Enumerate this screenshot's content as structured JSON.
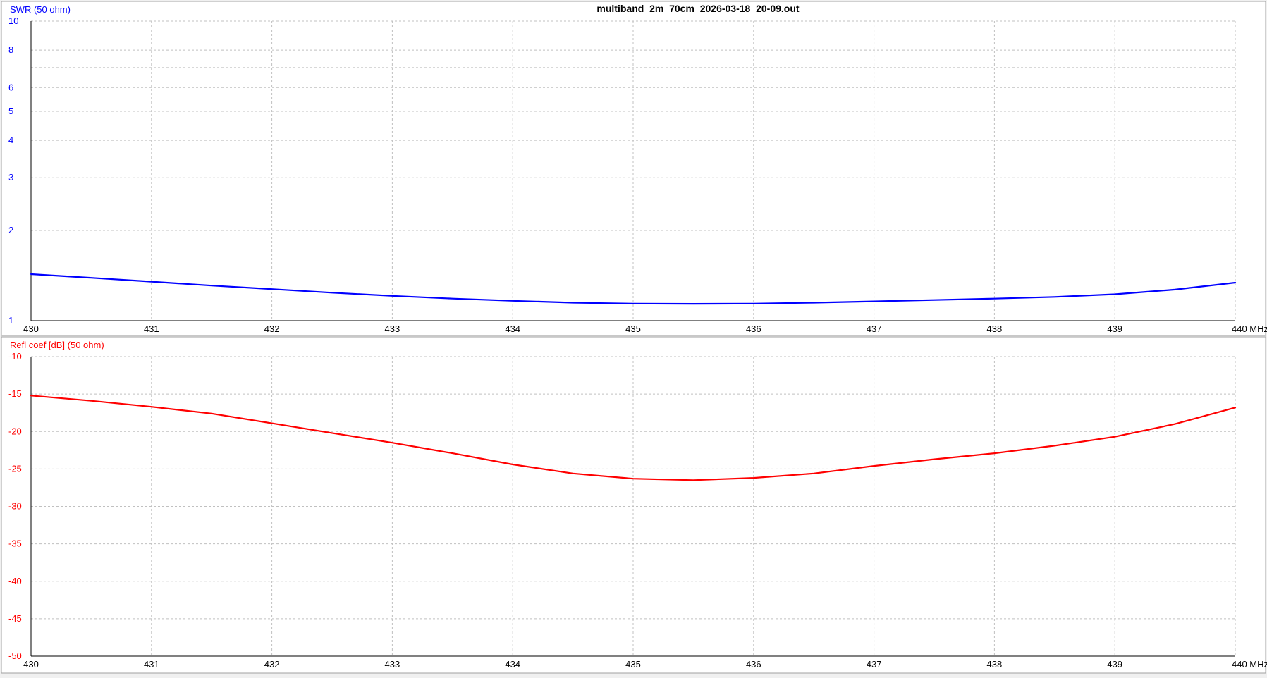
{
  "window": {
    "title": "multiband_2m_70cm_2026-03-18_20-09.out"
  },
  "colors": {
    "background": "#ffffff",
    "grid": "#c0c0c0",
    "axis": "#000000",
    "swr": "#0000ff",
    "refl": "#ff0000"
  },
  "chart_data": [
    {
      "type": "line",
      "ylabel": "SWR (50 ohm)",
      "xunit": "MHz",
      "xlim": [
        430,
        440
      ],
      "ylim": [
        1,
        10
      ],
      "yscale": "log",
      "grid": true,
      "x_ticks": [
        430,
        431,
        432,
        433,
        434,
        435,
        436,
        437,
        438,
        439,
        440
      ],
      "x_tick_labels": [
        "430",
        "431",
        "432",
        "433",
        "434",
        "435",
        "436",
        "437",
        "438",
        "439",
        "440 MHz"
      ],
      "y_ticks": [
        1,
        2,
        3,
        4,
        5,
        6,
        8,
        10
      ],
      "y_tick_labels": [
        "1",
        "2",
        "3",
        "4",
        "5",
        "6",
        "8",
        "10"
      ],
      "y_gridlines": [
        1,
        2,
        3,
        4,
        5,
        6,
        7,
        8,
        9,
        10
      ],
      "series": [
        {
          "x": [
            430,
            430.5,
            431,
            431.5,
            432,
            432.5,
            433,
            433.5,
            434,
            434.5,
            435,
            435.5,
            436,
            436.5,
            437,
            437.5,
            438,
            438.5,
            439,
            439.5,
            440
          ],
          "y": [
            1.43,
            1.39,
            1.35,
            1.31,
            1.275,
            1.24,
            1.21,
            1.185,
            1.165,
            1.148,
            1.14,
            1.138,
            1.14,
            1.148,
            1.16,
            1.172,
            1.185,
            1.2,
            1.225,
            1.27,
            1.34
          ]
        }
      ]
    },
    {
      "type": "line",
      "ylabel": "Refl coef [dB] (50 ohm)",
      "xunit": "MHz",
      "xlim": [
        430,
        440
      ],
      "ylim": [
        -50,
        -10
      ],
      "grid": true,
      "x_ticks": [
        430,
        431,
        432,
        433,
        434,
        435,
        436,
        437,
        438,
        439,
        440
      ],
      "x_tick_labels": [
        "430",
        "431",
        "432",
        "433",
        "434",
        "435",
        "436",
        "437",
        "438",
        "439",
        "440 MHz"
      ],
      "y_ticks": [
        -10,
        -15,
        -20,
        -25,
        -30,
        -35,
        -40,
        -45,
        -50
      ],
      "y_tick_labels": [
        "-10",
        "-15",
        "-20",
        "-25",
        "-30",
        "-35",
        "-40",
        "-45",
        "-50"
      ],
      "series": [
        {
          "x": [
            430,
            430.5,
            431,
            431.5,
            432,
            432.5,
            433,
            433.5,
            434,
            434.5,
            435,
            435.5,
            436,
            436.5,
            437,
            437.5,
            438,
            438.5,
            439,
            439.5,
            440
          ],
          "y": [
            -15.2,
            -15.9,
            -16.7,
            -17.6,
            -18.9,
            -20.2,
            -21.5,
            -22.9,
            -24.4,
            -25.6,
            -26.3,
            -26.5,
            -26.2,
            -25.6,
            -24.6,
            -23.7,
            -22.9,
            -21.9,
            -20.7,
            -19.0,
            -16.8
          ]
        }
      ]
    }
  ]
}
